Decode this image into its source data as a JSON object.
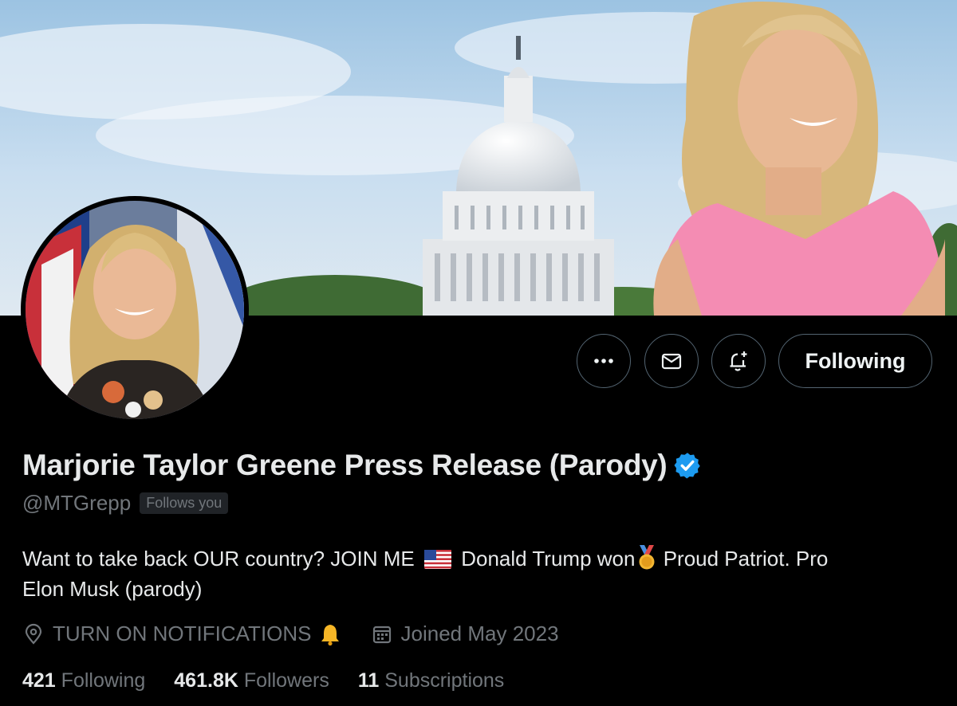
{
  "profile": {
    "display_name": "Marjorie Taylor Greene Press Release (Parody)",
    "handle": "@MTGrepp",
    "follows_you": "Follows you",
    "bio_part1": "Want to take back OUR country? JOIN ME",
    "bio_part2": "Donald Trump won",
    "bio_part3": "Proud Patriot. Pro",
    "bio_part4": "Elon Musk (parody)",
    "location": "TURN ON NOTIFICATIONS",
    "joined": "Joined May 2023"
  },
  "actions": {
    "more_icon": "more-icon",
    "message_icon": "mail-icon",
    "notify_icon": "bell-plus-icon",
    "following_label": "Following"
  },
  "stats": {
    "following_count": "421",
    "following_label": "Following",
    "followers_count": "461.8K",
    "followers_label": "Followers",
    "subscriptions_count": "11",
    "subscriptions_label": "Subscriptions"
  },
  "colors": {
    "background": "#000000",
    "verified": "#1d9bf0",
    "secondary_text": "#71767b",
    "button_border": "#536471"
  }
}
